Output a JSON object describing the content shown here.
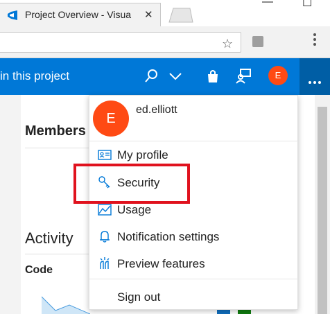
{
  "browser": {
    "tab_title": "Project Overview - Visua",
    "close_glyph": "✕",
    "minimize_glyph": "—",
    "maximize_glyph": "☐",
    "star_glyph": "☆"
  },
  "header": {
    "search_text": "in this project",
    "avatar_initial": "E"
  },
  "page": {
    "members_title": "Members",
    "activity_title": "Activity",
    "code_label": "Code"
  },
  "menu": {
    "user": {
      "initial": "E",
      "name": "ed.elliott"
    },
    "items": [
      {
        "label": "My profile",
        "icon": "profile-card-icon"
      },
      {
        "label": "Security",
        "icon": "key-icon"
      },
      {
        "label": "Usage",
        "icon": "usage-chart-icon"
      },
      {
        "label": "Notification settings",
        "icon": "bell-icon"
      },
      {
        "label": "Preview features",
        "icon": "preview-features-icon"
      }
    ],
    "sign_out": "Sign out"
  },
  "colors": {
    "accent": "#0078d7",
    "avatar": "#ff4a14",
    "highlight": "#e0121e"
  }
}
